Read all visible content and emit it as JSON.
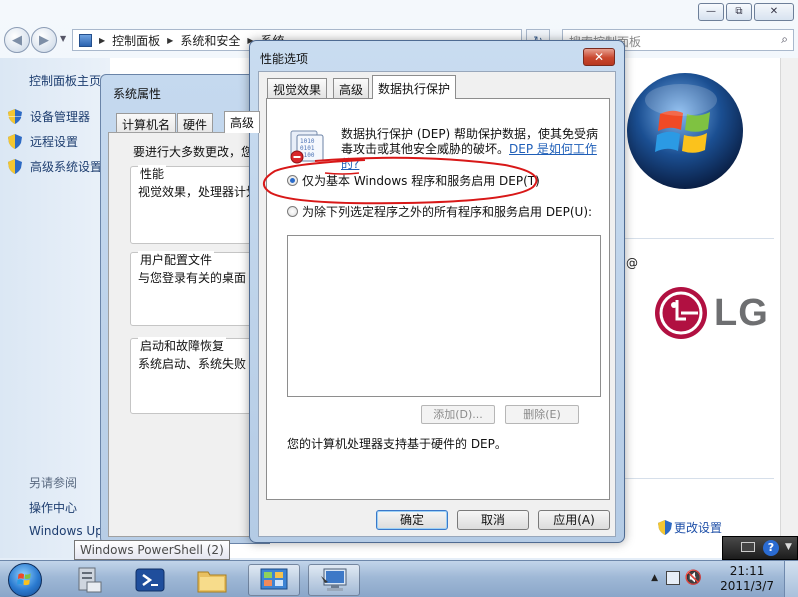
{
  "control_panel": {
    "breadcrumb": [
      "控制面板",
      "系统和安全",
      "系统"
    ],
    "search_placeholder": "搜索控制面板",
    "sidebar": {
      "home": "控制面板主页",
      "items": [
        {
          "label": "设备管理器",
          "icon": "shield-icon"
        },
        {
          "label": "远程设置",
          "icon": "shield-icon"
        },
        {
          "label": "高级系统设置",
          "icon": "shield-icon"
        }
      ],
      "see_also": "另请参阅",
      "action_center": "操作中心",
      "windows_update": "Windows Update"
    },
    "change_settings": "更改设置",
    "at_sign": "@",
    "lg_logo": "LG",
    "caption_buttons": [
      "minimize-icon",
      "maximize-icon",
      "close-icon"
    ]
  },
  "system_properties": {
    "title": "系统属性",
    "tabs": [
      "计算机名",
      "硬件",
      "高级"
    ],
    "intro": "要进行大多数更改，您",
    "sections": [
      {
        "title": "性能",
        "desc": "视觉效果，处理器计划"
      },
      {
        "title": "用户配置文件",
        "desc": "与您登录有关的桌面"
      },
      {
        "title": "启动和故障恢复",
        "desc": "系统启动、系统失败"
      }
    ]
  },
  "performance_options": {
    "title": "性能选项",
    "tabs": [
      "视觉效果",
      "高级",
      "数据执行保护"
    ],
    "active_tab": "数据执行保护",
    "description_line1": "数据执行保护 (DEP) 帮助保护数据，使其免受病",
    "description_line2": "毒攻击或其他安全威胁的破坏。",
    "help_link": "DEP 是如何工作的?",
    "radio_essential": "仅为基本 Windows 程序和服务启用 DEP(T)",
    "radio_all_except": "为除下列选定程序之外的所有程序和服务启用 DEP(U):",
    "selected_option": "radio_essential",
    "add_button": "添加(D)...",
    "remove_button": "删除(E)",
    "hardware_support": "您的计算机处理器支持基于硬件的 DEP。",
    "ok_button": "确定",
    "cancel_button": "取消",
    "apply_button": "应用(A)"
  },
  "tooltip": "Windows PowerShell (2)",
  "taskbar": {
    "items": [
      "start-orb-icon",
      "server-manager-icon",
      "powershell-icon",
      "explorer-icon",
      "control-panel-icon",
      "system-icon"
    ],
    "clock_time": "21:11",
    "clock_date": "2011/3/7"
  },
  "colors": {
    "annotation_red": "#d81818",
    "link_blue": "#1f5fb8",
    "dialog_frame": "#b4cbe5"
  }
}
